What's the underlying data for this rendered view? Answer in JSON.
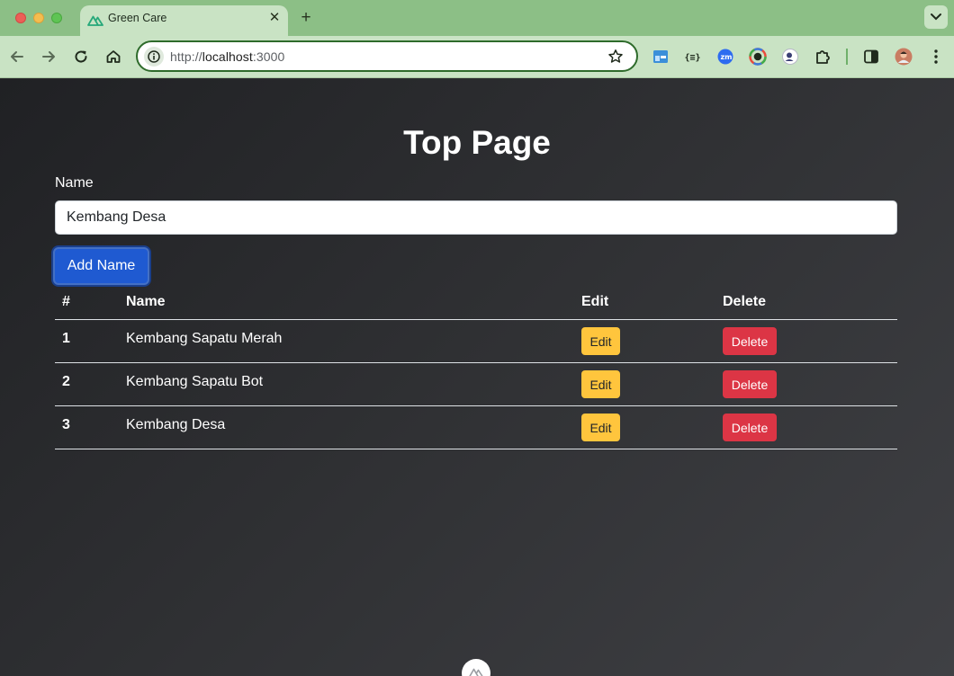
{
  "browser": {
    "tab": {
      "title": "Green Care",
      "close_glyph": "✕",
      "favicon": "nuxt-icon"
    },
    "new_tab_glyph": "+",
    "address": {
      "protocol": "http://",
      "host": "localhost",
      "port": ":3000"
    },
    "colors": {
      "frame": "#8cbf86",
      "toolbar": "#c9e3c4"
    }
  },
  "page": {
    "title": "Top Page",
    "form": {
      "label": "Name",
      "value": "Kembang Desa",
      "button": "Add Name"
    },
    "table": {
      "headers": {
        "num": "#",
        "name": "Name",
        "edit": "Edit",
        "delete": "Delete"
      },
      "rows": [
        {
          "num": "1",
          "name": "Kembang Sapatu Merah",
          "edit": "Edit",
          "delete": "Delete"
        },
        {
          "num": "2",
          "name": "Kembang Sapatu Bot",
          "edit": "Edit",
          "delete": "Delete"
        },
        {
          "num": "3",
          "name": "Kembang Desa",
          "edit": "Edit",
          "delete": "Delete"
        }
      ]
    },
    "colors": {
      "primary": "#1f5ad1",
      "warning": "#ffc53d",
      "danger": "#dc3545"
    }
  }
}
